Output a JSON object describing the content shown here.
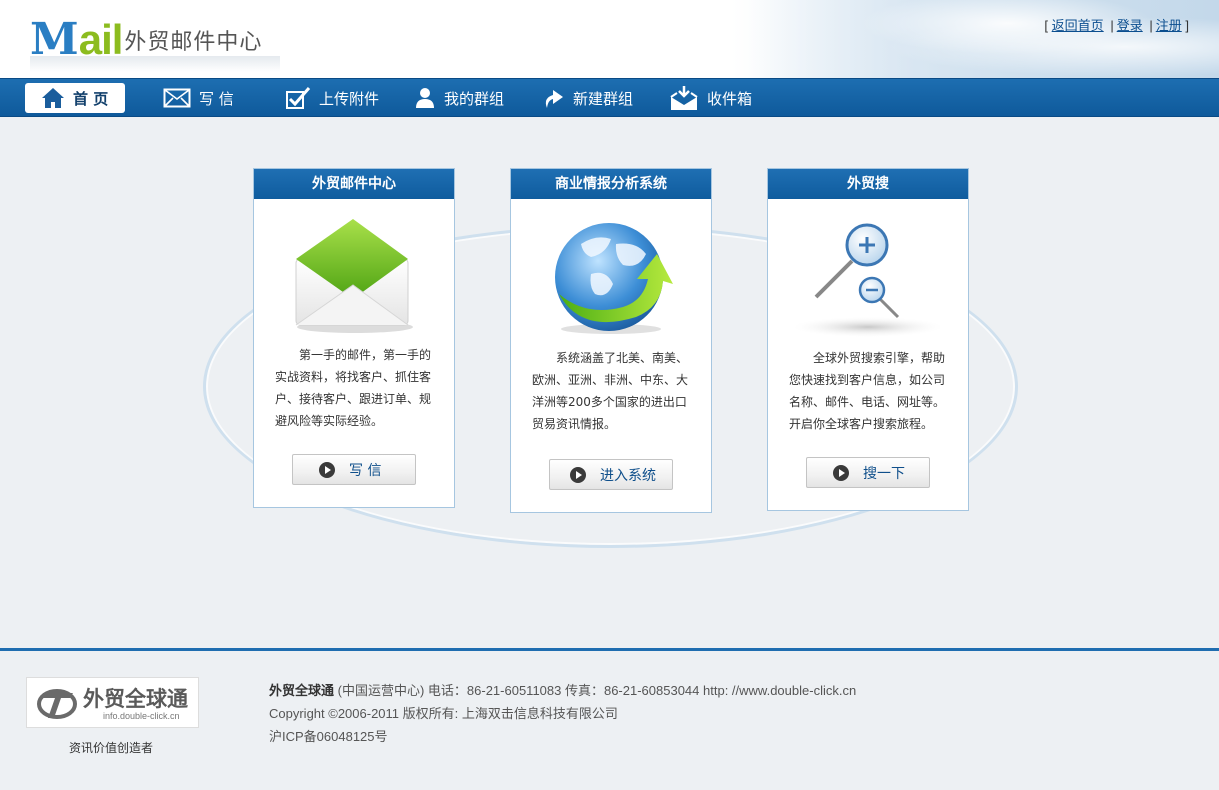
{
  "header": {
    "logo_m": "M",
    "logo_ail": "ail",
    "logo_title": "外贸邮件中心",
    "toplinks": {
      "open": "[",
      "back_home": "返回首页",
      "sep1": "|",
      "login": "登录",
      "sep2": "|",
      "register": "注册",
      "close": "]"
    }
  },
  "nav": {
    "items": [
      {
        "label": "首 页",
        "icon": "home-icon",
        "active": true
      },
      {
        "label": "写 信",
        "icon": "envelope-icon"
      },
      {
        "label": "上传附件",
        "icon": "checkbox-icon"
      },
      {
        "label": "我的群组",
        "icon": "user-icon"
      },
      {
        "label": "新建群组",
        "icon": "redo-arrow-icon"
      },
      {
        "label": "收件箱",
        "icon": "inbox-icon"
      }
    ]
  },
  "cards": [
    {
      "title": "外贸邮件中心",
      "icon": "envelope-image",
      "text": "第一手的邮件，第一手的实战资料，将找客户、抓住客户、接待客户、跟进订单、规避风险等实际经验。",
      "button": "写  信"
    },
    {
      "title": "商业情报分析系统",
      "icon": "globe-image",
      "text": "系统涵盖了北美、南美、欧洲、亚洲、非洲、中东、大洋洲等200多个国家的进出口贸易资讯情报。",
      "button": "进入系统"
    },
    {
      "title": "外贸搜",
      "icon": "magnifier-image",
      "text": "全球外贸搜索引擎，帮助您快速找到客户信息，如公司名称、邮件、电话、网址等。开启你全球客户搜索旅程。",
      "button": "搜一下"
    }
  ],
  "footer": {
    "logo_text": "外贸全球通",
    "logo_url": "info.double-click.cn",
    "slogan": "资讯价值创造者",
    "line1_bold": "外贸全球通",
    "line1_rest": "(中国运营中心) 电话：86-21-60511083 传真：86-21-60853044 http: //www.double-click.cn",
    "line2": "Copyright ©2006-2011 版权所有: 上海双击信息科技有限公司",
    "line3": "沪ICP备06048125号"
  },
  "colors": {
    "nav_blue": "#1765a8",
    "card_header": "#1565a8",
    "accent_green": "#8cbc1f",
    "background": "#edf0f3"
  }
}
